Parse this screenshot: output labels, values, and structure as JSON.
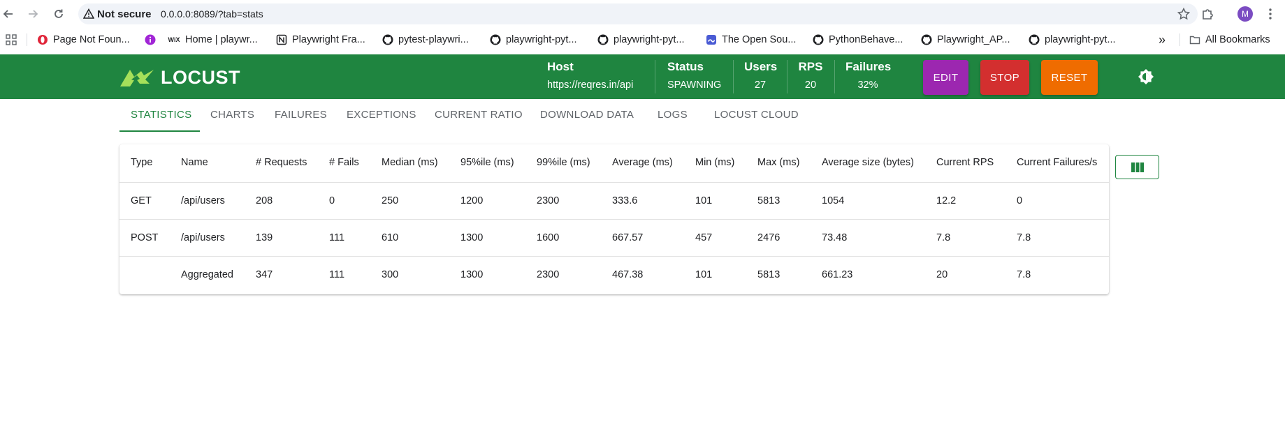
{
  "browser": {
    "security_label": "Not secure",
    "url": "0.0.0.0:8089/?tab=stats",
    "avatar_letter": "M",
    "bookmarks": [
      {
        "label": "Page Not Foun...",
        "icon": "opera-icon"
      },
      {
        "label": "",
        "icon": "info-circle-icon"
      },
      {
        "label": "Home | playwr...",
        "icon": "wix-icon"
      },
      {
        "label": "Playwright Fra...",
        "icon": "notion-icon"
      },
      {
        "label": "pytest-playwri...",
        "icon": "github-icon"
      },
      {
        "label": "playwright-pyt...",
        "icon": "github-icon"
      },
      {
        "label": "playwright-pyt...",
        "icon": "github-icon"
      },
      {
        "label": "The Open Sou...",
        "icon": "site-icon"
      },
      {
        "label": "PythonBehave...",
        "icon": "github-icon"
      },
      {
        "label": "Playwright_AP...",
        "icon": "github-icon"
      },
      {
        "label": "playwright-pyt...",
        "icon": "github-icon"
      }
    ],
    "more_bookmarks": "»",
    "all_bookmarks": "All Bookmarks"
  },
  "header": {
    "logo_text": "LOCUST",
    "host_label": "Host",
    "host_value": "https://reqres.in/api",
    "status_label": "Status",
    "status_value": "SPAWNING",
    "users_label": "Users",
    "users_value": "27",
    "rps_label": "RPS",
    "rps_value": "20",
    "failures_label": "Failures",
    "failures_value": "32%",
    "edit_label": "EDIT",
    "stop_label": "STOP",
    "reset_label": "RESET",
    "colors": {
      "header": "#1f8540",
      "edit": "#9c27b0",
      "stop": "#d32f2f",
      "reset": "#ef6c00"
    }
  },
  "tabs": [
    "STATISTICS",
    "CHARTS",
    "FAILURES",
    "EXCEPTIONS",
    "CURRENT RATIO",
    "DOWNLOAD DATA",
    "LOGS",
    "LOCUST CLOUD"
  ],
  "active_tab": "STATISTICS",
  "table": {
    "columns": [
      "Type",
      "Name",
      "# Requests",
      "# Fails",
      "Median (ms)",
      "95%ile (ms)",
      "99%ile (ms)",
      "Average (ms)",
      "Min (ms)",
      "Max (ms)",
      "Average size (bytes)",
      "Current RPS",
      "Current Failures/s"
    ],
    "rows": [
      [
        "GET",
        "/api/users",
        "208",
        "0",
        "250",
        "1200",
        "2300",
        "333.6",
        "101",
        "5813",
        "1054",
        "12.2",
        "0"
      ],
      [
        "POST",
        "/api/users",
        "139",
        "111",
        "610",
        "1300",
        "1600",
        "667.57",
        "457",
        "2476",
        "73.48",
        "7.8",
        "7.8"
      ],
      [
        "",
        "Aggregated",
        "347",
        "111",
        "300",
        "1300",
        "2300",
        "467.38",
        "101",
        "5813",
        "661.23",
        "20",
        "7.8"
      ]
    ],
    "column_selector_icon": "columns-icon"
  }
}
